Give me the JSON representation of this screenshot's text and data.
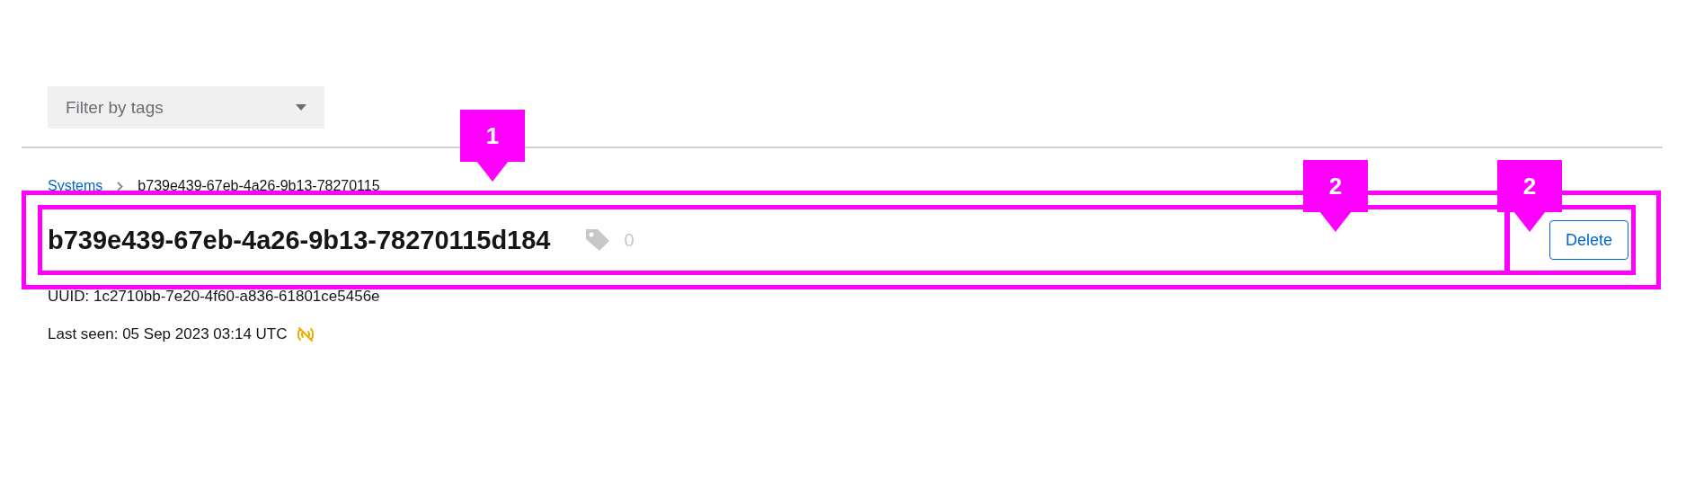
{
  "filter": {
    "placeholder": "Filter by tags"
  },
  "breadcrumb": [
    {
      "label": "Systems",
      "kind": "link"
    },
    {
      "label": "b739e439-67eb-4a26-9b13-78270115",
      "kind": "current"
    }
  ],
  "title": "b739e439-67eb-4a26-9b13-78270115d184",
  "tag_count": "0",
  "uuid": "UUID: 1c2710bb-7e20-4f60-a836-61801ce5456e",
  "last_seen": "Last seen: 05 Sep 2023 03:14 UTC",
  "stale": true,
  "delete_button": "Delete",
  "annotations": [
    {
      "label": "1"
    },
    {
      "label": "2"
    },
    {
      "label": "2"
    }
  ]
}
